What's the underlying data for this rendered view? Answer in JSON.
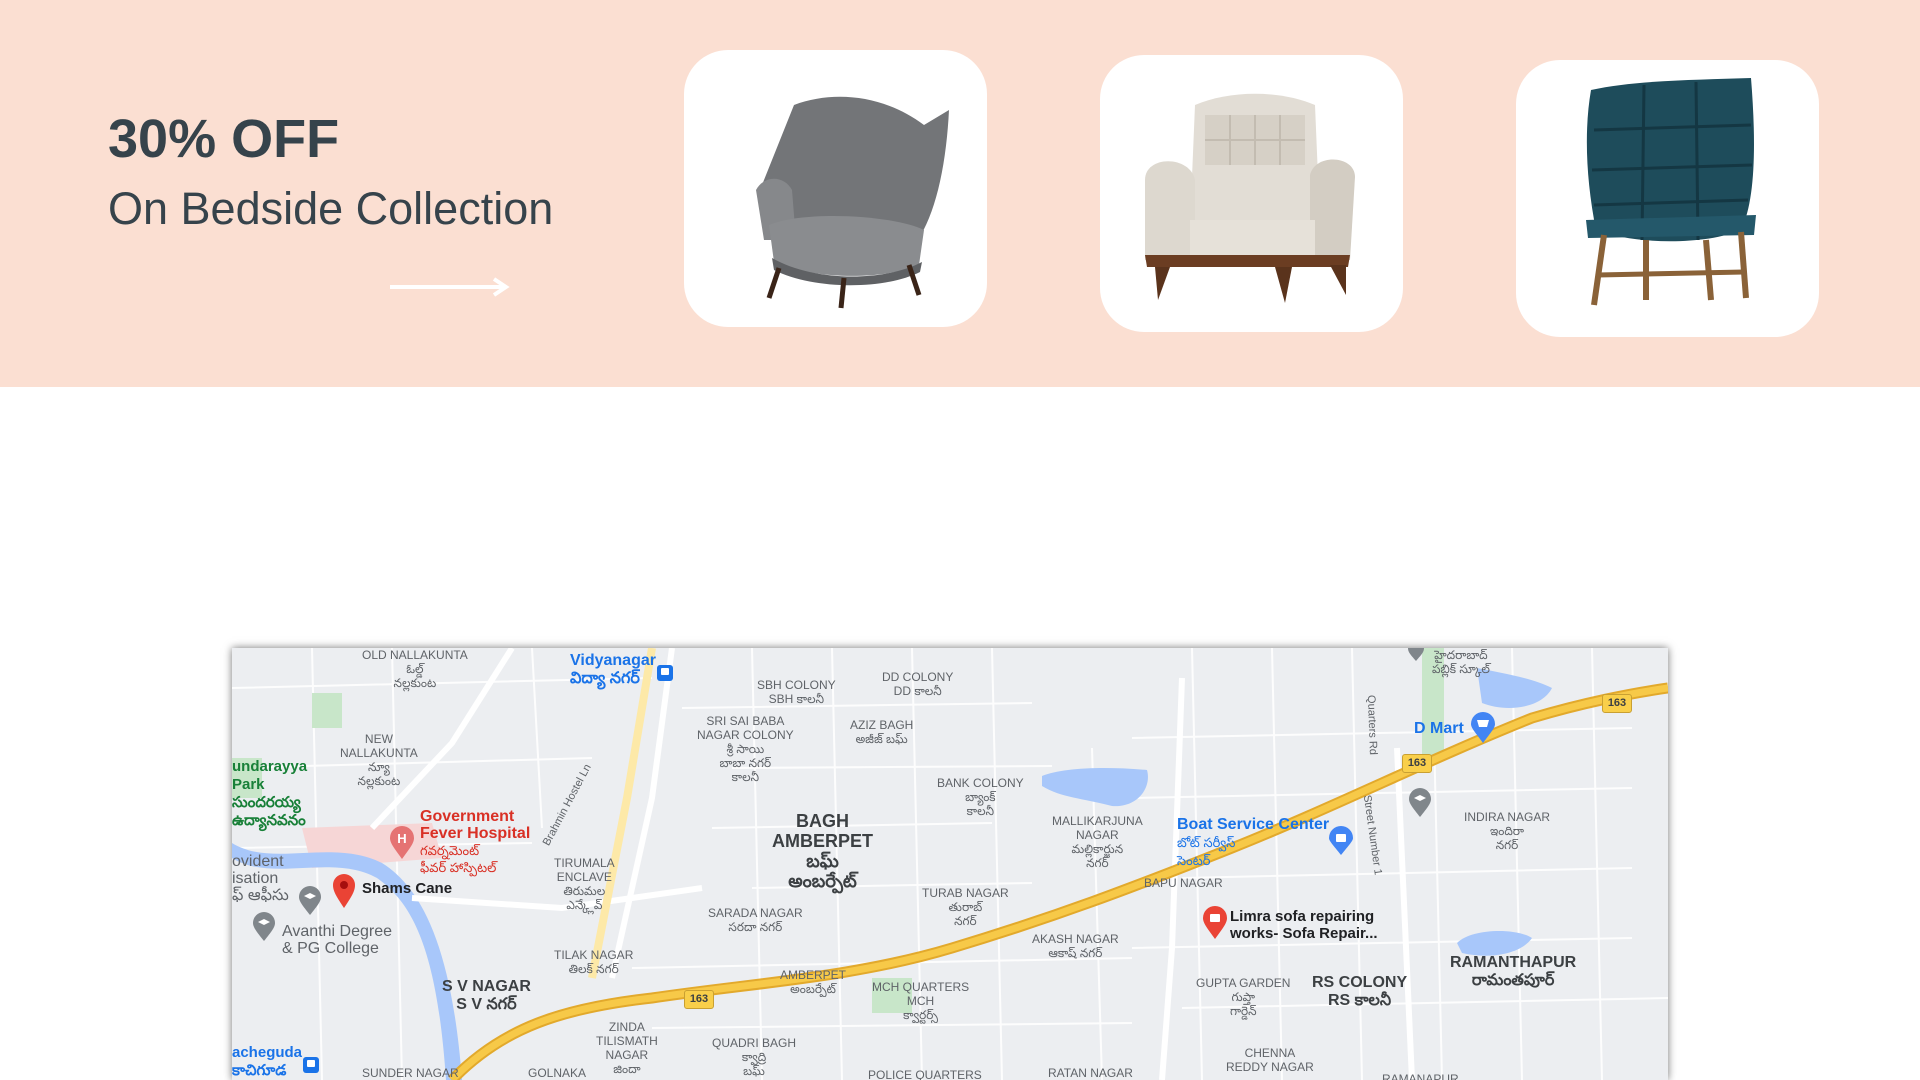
{
  "promo": {
    "title": "30% OFF",
    "subtitle": "On Bedside Collection",
    "arrow_icon": "arrow-right-icon"
  },
  "products": [
    {
      "name": "grey-wingback-armchair",
      "color": "#6f7173"
    },
    {
      "name": "cream-tufted-armchair",
      "color": "#d9d4cb"
    },
    {
      "name": "teal-quilted-chair",
      "color": "#1f4f5e"
    }
  ],
  "map": {
    "colors": {
      "road_major": "#f7c948",
      "water": "#a8c7fa",
      "park": "#c8e6c9",
      "poi_red": "#d93025",
      "poi_blue": "#1a73e8"
    },
    "labels": {
      "old_nallakunta": "OLD NALLAKUNTA",
      "old_nallakunta_te": "ఓల్డ్\nనల్లకుంట",
      "vidyanagar": "Vidyanagar",
      "vidyanagar_te": "విద్యా నగర్",
      "sbh_colony": "SBH COLONY\nSBH కాలనీ",
      "dd_colony": "DD COLONY\nDD కాలనీ",
      "sri_sai_baba": "SRI SAI BABA\nNAGAR COLONY\nశ్రీ సాయి\nబాబా నగర్\nకాలనీ",
      "aziz_bagh": "AZIZ BAGH\nఅజీజ్ బఘ్",
      "new_nallakunta": "NEW\nNALLAKUNTA\nన్యూ\nనల్లకుంట",
      "sundarayya_park": "undarayya\nPark\nసుందరయ్య\nఉద్యానవనం",
      "brahmin_hostel": "Brahmin Hostel Ln",
      "bank_colony": "BANK COLONY\nబ్యాంక్\nకాలనీ",
      "govt_fever": "Government\nFever Hospital",
      "govt_fever_te": "గవర్నమెంట్\nఫీవర్ హాస్పిటల్",
      "bagh_amberpet": "BAGH\nAMBERPET",
      "bagh_amberpet_te": "బఘ్\nఅంబర్పేట్",
      "mallikarjuna": "MALLIKARJUNA\nNAGAR\nమల్లికార్జున\nనగర్",
      "boat_service": "Boat Service Center",
      "boat_service_te": "బోట్ సర్వీస్\nసెంటర్",
      "provident": "ovident\nisation\nఫ్ ఆఫీసు",
      "shams_cane": "Shams Cane",
      "tirumala": "TIRUMALA\nENCLAVE\nతిరుమల\nఎన్క్లేవ్",
      "turab_nagar": "TURAB NAGAR\nతురాబ్\nనగర్",
      "bapu_nagar": "BAPU NAGAR",
      "sarada_nagar": "SARADA NAGAR\nసరదా నగర్",
      "limra": "Limra sofa repairing\nworks- Sofa Repair...",
      "avanthi": "Avanthi Degree\n& PG College",
      "akash_nagar": "AKASH NAGAR\nఆకాష్ నగర్",
      "tilak_nagar": "TILAK NAGAR\nతిలక్ నగర్",
      "amberpet": "AMBERPET\nఅంబర్పేట్",
      "sv_nagar": "S V NAGAR\nS V నగర్",
      "mch_quarters": "MCH QUARTERS\nMCH\nక్వార్టర్స్",
      "gupta_garden": "GUPTA GARDEN\nగుప్తా\nగార్డెన్",
      "rs_colony": "RS COLONY\nRS కాలనీ",
      "ramanthapur": "RAMANTHAPUR\nరామంతపూర్",
      "zinda": "ZINDA\nTILISMATH\nNAGAR\nజిందా",
      "quadri_bagh": "QUADRI BAGH\nక్వాద్రి\nబఘ్",
      "chenna_reddy": "CHENNA\nREDDY NAGAR",
      "acheguda": "acheguda\nకాచిగూడ",
      "sunder_nagar": "SUNDER NAGAR",
      "golnaka": "GOLNAKA",
      "police_quarters": "POLICE QUARTERS",
      "ratan_nagar": "RATAN NAGAR",
      "ramanapur": "RAMANAPUR",
      "d_mart": "D Mart",
      "public_school_te": "హైదరాబాద్\nపబ్లిక్ స్కూల్",
      "quarters_rd": "Quarters Rd",
      "street_no1": "Street Number 1",
      "indira_nagar": "INDIRA NAGAR\nఇందిరా\nనగర్",
      "hwy_163": "163"
    }
  }
}
